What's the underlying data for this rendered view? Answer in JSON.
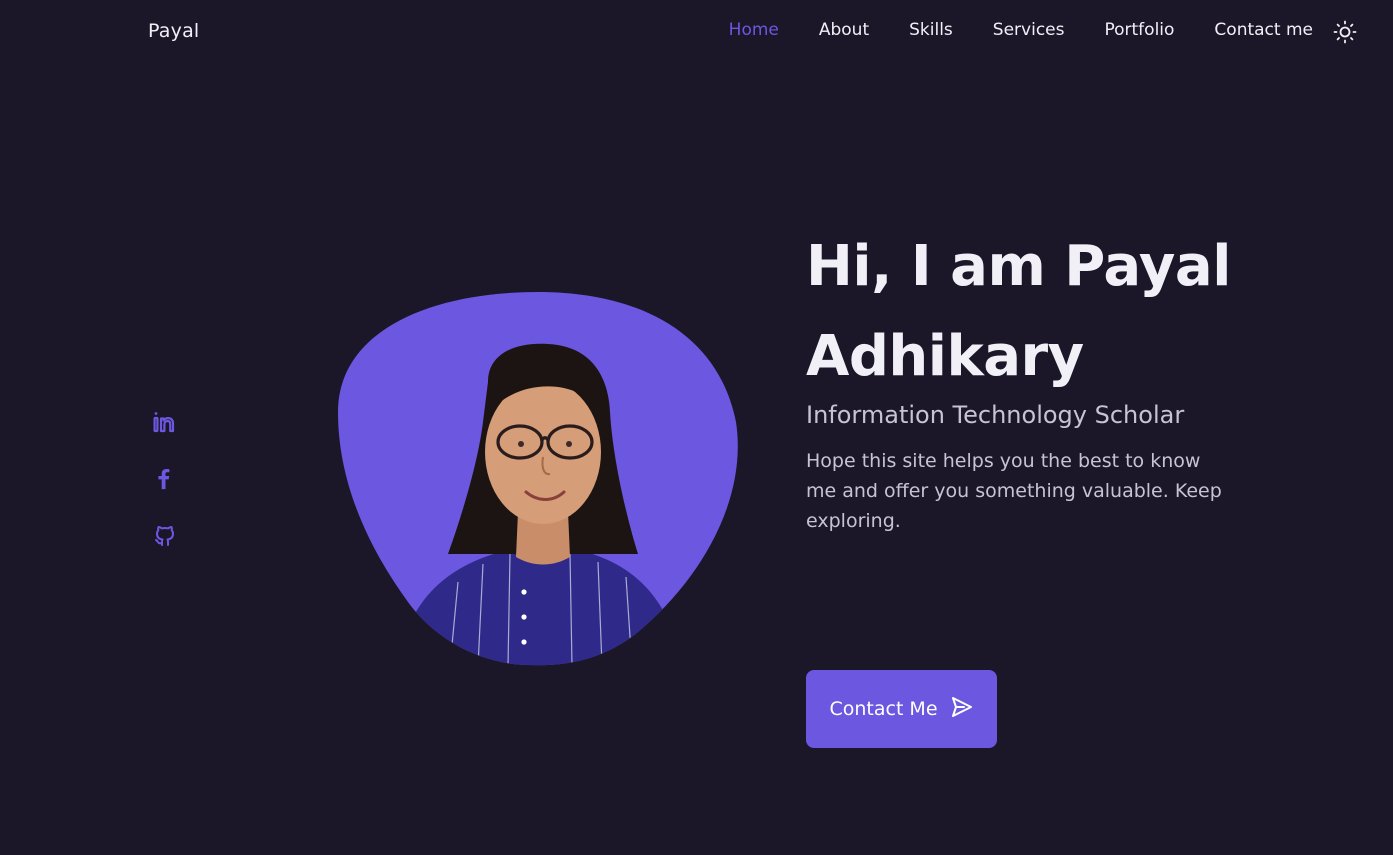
{
  "header": {
    "logo": "Payal",
    "nav": [
      {
        "label": "Home",
        "active": true
      },
      {
        "label": "About",
        "active": false
      },
      {
        "label": "Skills",
        "active": false
      },
      {
        "label": "Services",
        "active": false
      },
      {
        "label": "Portfolio",
        "active": false
      },
      {
        "label": "Contact me",
        "active": false
      }
    ],
    "theme_icon": "sun-icon"
  },
  "social": [
    {
      "icon": "linkedin-icon"
    },
    {
      "icon": "facebook-icon"
    },
    {
      "icon": "github-icon"
    }
  ],
  "hero": {
    "title": "Hi, I am Payal Adhikary",
    "subtitle": "Information Technology Scholar",
    "description": "Hope this site helps you the best to know me and offer you something valuable. Keep exploring.",
    "cta_label": "Contact Me",
    "cta_icon": "send-icon"
  },
  "colors": {
    "background": "#1b1729",
    "accent": "#6c57e0",
    "text": "#f1f0f6",
    "muted_text": "#c6c3d2"
  }
}
